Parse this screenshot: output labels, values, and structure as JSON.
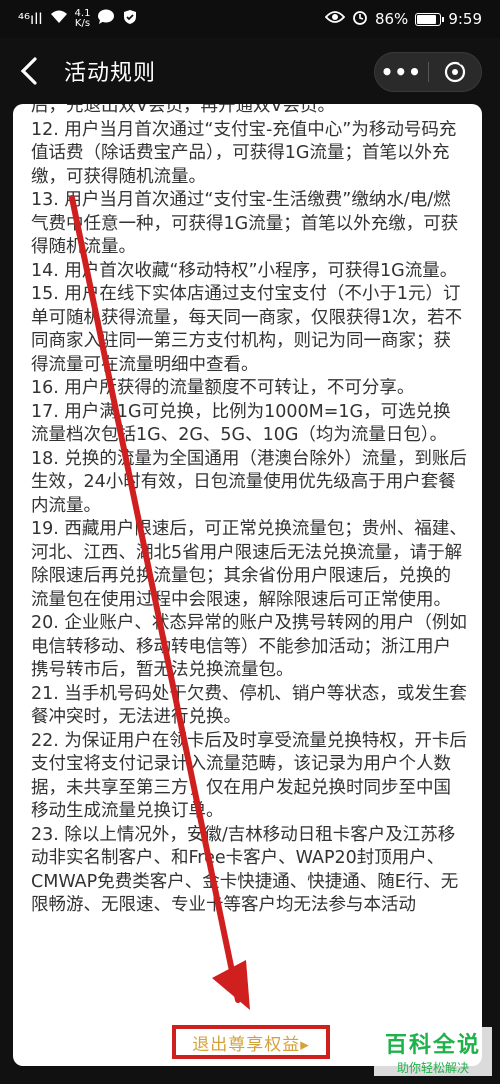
{
  "status_bar": {
    "signal": "⁴⁶ıll",
    "net_speed_value": "4.1",
    "net_speed_unit": "K/s",
    "battery_percent": "86%",
    "battery_level": 0.86,
    "time": "9:59"
  },
  "nav": {
    "back_glyph": "‹",
    "title": "活动规则",
    "more_glyph": "•••"
  },
  "rules": [
    "后，先退出双V会员，再开通双V会员。",
    "12. 用户当月首次通过“支付宝-充值中心”为移动号码充值话费（除话费宝产品），可获得1G流量；首笔以外充缴，可获得随机流量。",
    "13. 用户当月首次通过“支付宝-生活缴费”缴纳水/电/燃气费中任意一种，可获得1G流量；首笔以外充缴，可获得随机流量。",
    "14. 用户首次收藏“移动特权”小程序，可获得1G流量。",
    "15. 用户在线下实体店通过支付宝支付（不小于1元）订单可随机获得流量，每天同一商家，仅限获得1次，若不同商家入驻同一第三方支付机构，则记为同一商家；获得流量可在流量明细中查看。",
    "16. 用户所获得的流量额度不可转让，不可分享。",
    "17. 用户满1G可兑换，比例为1000M=1G，可选兑换流量档次包括1G、2G、5G、10G（均为流量日包）。",
    "18. 兑换的流量为全国通用（港澳台除外）流量，到账后生效，24小时有效，日包流量使用优先级高于用户套餐内流量。",
    "19. 西藏用户限速后，可正常兑换流量包；贵州、福建、河北、江西、湖北5省用户限速后无法兑换流量，请于解除限速后再兑换流量包；其余省份用户限速后，兑换的流量包在使用过程中会限速，解除限速后可正常使用。",
    "20. 企业账户、状态异常的账户及携号转网的用户（例如电信转移动、移动转电信等）不能参加活动；浙江用户携号转市后，暂无法兑换流量包。",
    "21. 当手机号码处于欠费、停机、销户等状态，或发生套餐冲突时，无法进行兑换。",
    "22. 为保证用户在领卡后及时享受流量兑换特权，开卡后支付宝将支付记录计入流量范畴，该记录为用户个人数据，未共享至第三方，仅在用户发起兑换时同步至中国移动生成流量兑换订单。",
    "23. 除以上情况外，安徽/吉林移动日租卡客户及江苏移动非实名制客户、和Free卡客户、WAP20封顶用户、CMWAP免费类客户、金卡快捷通、快捷通、随E行、无限畅游、无限速、专业卡等客户均无法参与本活动"
  ],
  "exit_link": "退出尊享权益▸",
  "watermark": {
    "main": "百科全说",
    "sub": "助你轻松解决"
  },
  "colors": {
    "annotation_red": "#d01f1f",
    "link_gold": "#d4a23a",
    "watermark_green": "#1fb24a"
  }
}
